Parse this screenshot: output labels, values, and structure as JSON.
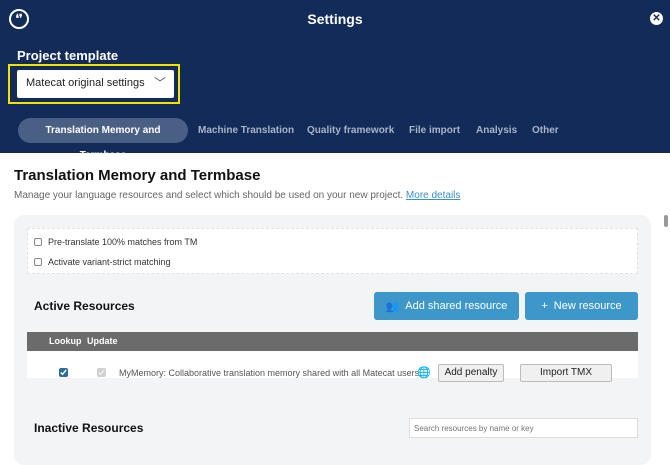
{
  "header": {
    "title": "Settings",
    "logo_icon": "quote-logo-icon",
    "close_icon": "close-icon"
  },
  "project_template": {
    "label": "Project template",
    "selected": "Matecat original settings"
  },
  "tabs": [
    {
      "label": "Translation Memory and Termbase",
      "active": true
    },
    {
      "label": "Machine Translation"
    },
    {
      "label": "Quality framework"
    },
    {
      "label": "File import"
    },
    {
      "label": "Analysis"
    },
    {
      "label": "Other"
    }
  ],
  "section": {
    "title": "Translation Memory and Termbase",
    "description": "Manage your language resources and select which should be used on your new project.",
    "link": "More details"
  },
  "options": [
    {
      "label": "Pre-translate 100% matches from TM",
      "checked": false
    },
    {
      "label": "Activate variant-strict matching",
      "checked": false
    }
  ],
  "active": {
    "title": "Active Resources",
    "add_shared": "Add shared resource",
    "new_resource": "New resource",
    "columns": [
      "Lookup",
      "Update"
    ],
    "row": {
      "lookup": true,
      "update": true,
      "name": "MyMemory: Collaborative translation memory shared with all Matecat users.",
      "penalty": "Add penalty",
      "import": "Import TMX"
    }
  },
  "inactive": {
    "title": "Inactive Resources",
    "search_placeholder": "Search resources by name or key"
  },
  "colors": {
    "header": "#122b59",
    "accent": "#3e97c9",
    "highlight": "#f2e200"
  }
}
